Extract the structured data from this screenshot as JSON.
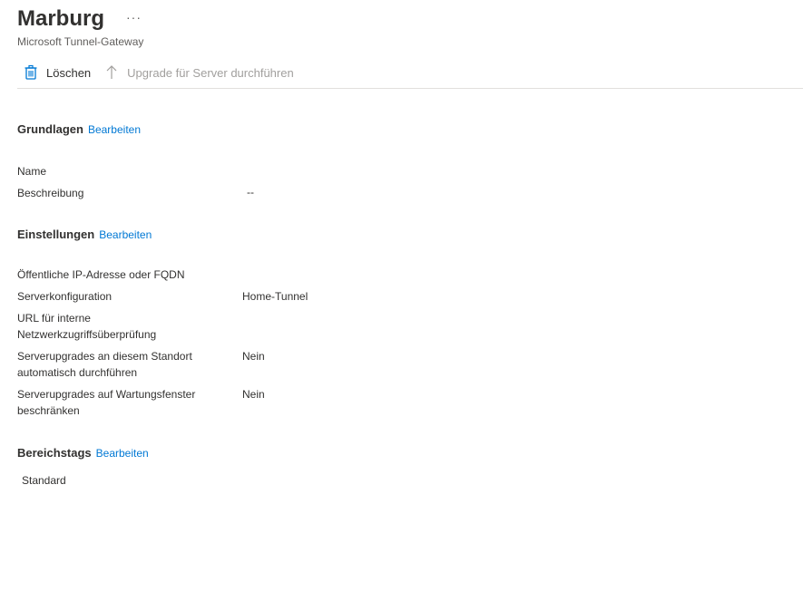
{
  "header": {
    "title": "Marburg",
    "more": "···",
    "subtitle": "Microsoft Tunnel-Gateway"
  },
  "toolbar": {
    "delete_label": "Löschen",
    "delete_icon": "trash-icon",
    "upgrade_label": "Upgrade für Server durchführen",
    "upgrade_icon": "arrow-up-icon",
    "accent": "#0078d4"
  },
  "basics": {
    "title": "Grundlagen",
    "edit": "Bearbeiten",
    "name_label": "Name",
    "name_value": "",
    "desc_label": "Beschreibung",
    "desc_value": "--"
  },
  "settings": {
    "title": "Einstellungen",
    "edit": "Bearbeiten",
    "ip_label": "Öffentliche IP-Adresse oder FQDN",
    "ip_value": "",
    "config_label": "Serverkonfiguration",
    "config_value": "Home-Tunnel",
    "url_label_1": "URL für interne",
    "url_label_2": "Netzwerkzugriffsüberprüfung",
    "url_value": "",
    "auto_label_1": "Serverupgrades an diesem Standort",
    "auto_label_2": "automatisch durchführen",
    "auto_value": "Nein",
    "maint_label_1": "Serverupgrades auf Wartungsfenster",
    "maint_label_2": "beschränken",
    "maint_value": "Nein"
  },
  "scope_tags": {
    "title": "Bereichstags",
    "edit": "Bearbeiten",
    "items": [
      "Standard"
    ]
  }
}
